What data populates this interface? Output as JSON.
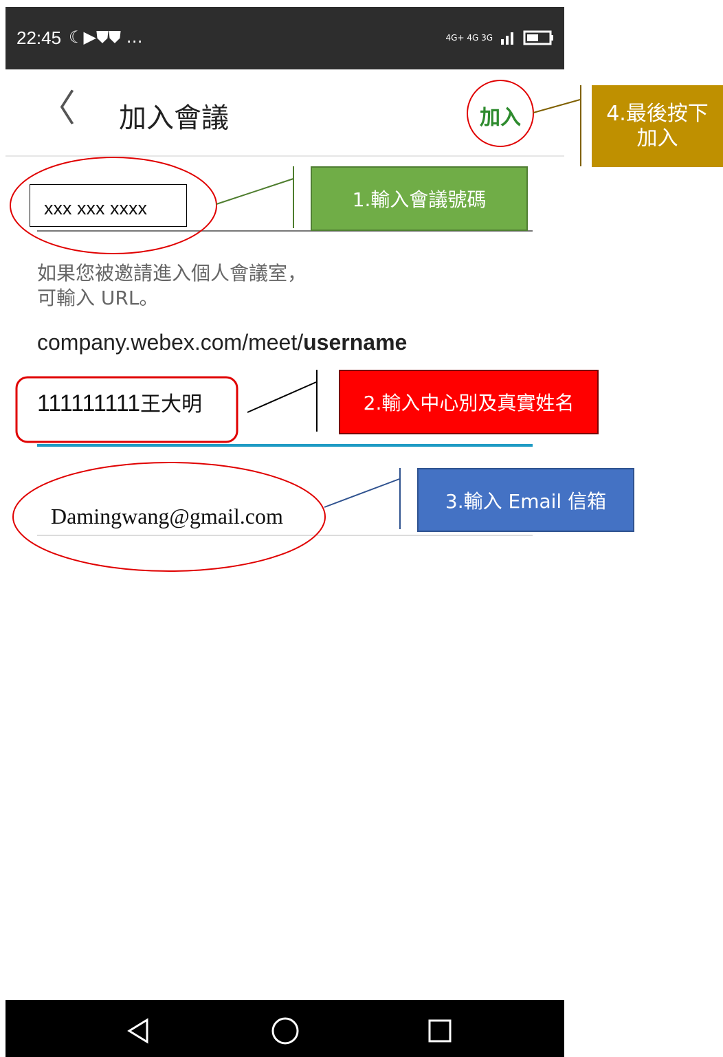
{
  "status_bar": {
    "time": "22:45",
    "left_icons": "☾▶⛊⛊ …",
    "right_icons": "4G+ 4G 3G"
  },
  "app_bar": {
    "back_glyph": "〈",
    "title": "加入會議",
    "join_label": "加入"
  },
  "form": {
    "meeting_number": "xxx xxx xxxx",
    "hint_line1": "如果您被邀請進入個人會議室，",
    "hint_line2": "可輸入 URL。",
    "url_prefix": "company.webex.com/meet/",
    "url_suffix": "username",
    "name_digits": "111111111",
    "name_text": "王大明",
    "email": "Damingwang@gmail.com"
  },
  "callouts": {
    "step1": "1.輸入會議號碼",
    "step2": "2.輸入中心別及真實姓名",
    "step3": "3.輸入 Email 信箱",
    "step4_line1": "4.最後按下",
    "step4_line2": "加入"
  },
  "colors": {
    "status_bar": "#2d2d2d",
    "join_green": "#2e8b2e",
    "focus_underline": "#1f9bc4",
    "annotation_red": "#e00000",
    "callout1": "#70ad47",
    "callout2": "#ff0000",
    "callout3": "#4472c4",
    "callout4": "#bf9000"
  }
}
